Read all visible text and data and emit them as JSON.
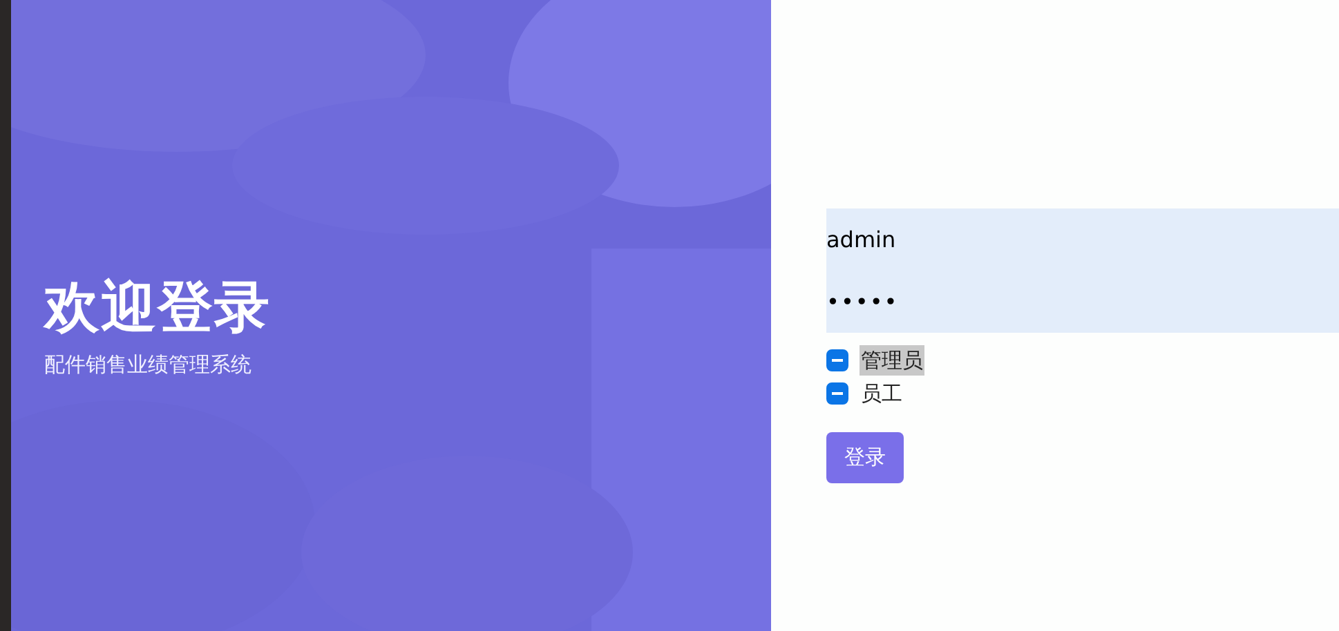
{
  "welcome": {
    "title": "欢迎登录",
    "subtitle": "配件销售业绩管理系统"
  },
  "form": {
    "username": {
      "value": "admin"
    },
    "password": {
      "value": "•••••"
    },
    "roles": [
      {
        "label": "管理员",
        "indeterminate": true,
        "highlighted": true
      },
      {
        "label": "员工",
        "indeterminate": true,
        "highlighted": false
      }
    ],
    "submit": "登录"
  }
}
